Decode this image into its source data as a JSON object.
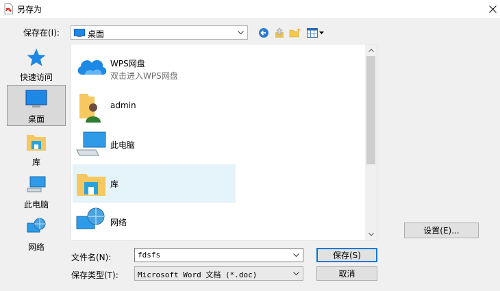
{
  "window": {
    "title": "另存为"
  },
  "save_in": {
    "label": "保存在(I):",
    "value": "桌面"
  },
  "places": [
    {
      "label": "快速访问"
    },
    {
      "label": "桌面"
    },
    {
      "label": "库"
    },
    {
      "label": "此电脑"
    },
    {
      "label": "网络"
    }
  ],
  "files": [
    {
      "name": "WPS网盘",
      "sub": "双击进入WPS网盘"
    },
    {
      "name": "admin"
    },
    {
      "name": "此电脑"
    },
    {
      "name": "库"
    },
    {
      "name": "网络"
    }
  ],
  "filename": {
    "label": "文件名(N):",
    "value": "fdsfs"
  },
  "filetype": {
    "label": "保存类型(T):",
    "value": "Microsoft Word 文档 (*.doc)"
  },
  "buttons": {
    "save": "保存(S)",
    "cancel": "取消",
    "settings": "设置(E)..."
  },
  "colors": {
    "accent": "#0078d7",
    "selected_row": "#e5f3fb"
  }
}
